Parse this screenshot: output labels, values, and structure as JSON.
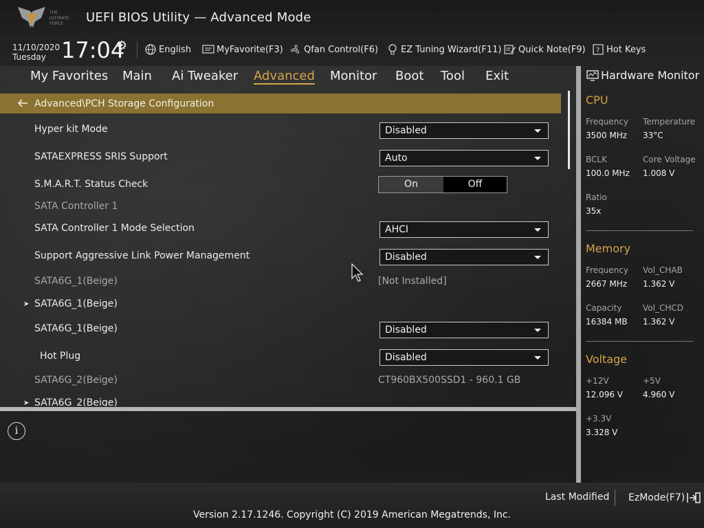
{
  "app": {
    "title": "UEFI BIOS Utility — Advanced Mode",
    "logo_text": "THE ULTIMATE FORCE"
  },
  "datetime": {
    "date": "11/10/2020",
    "weekday": "Tuesday",
    "time": "17:04"
  },
  "toolbar": {
    "language": "English",
    "my_favorite": "MyFavorite(F3)",
    "qfan": "Qfan Control(F6)",
    "ez_tuning": "EZ Tuning Wizard(F11)",
    "quick_note": "Quick Note(F9)",
    "hot_keys": "Hot Keys"
  },
  "tabs": [
    {
      "label": "My Favorites",
      "active": false
    },
    {
      "label": "Main",
      "active": false
    },
    {
      "label": "Ai Tweaker",
      "active": false
    },
    {
      "label": "Advanced",
      "active": true
    },
    {
      "label": "Monitor",
      "active": false
    },
    {
      "label": "Boot",
      "active": false
    },
    {
      "label": "Tool",
      "active": false
    },
    {
      "label": "Exit",
      "active": false
    }
  ],
  "breadcrumb": "Advanced\\PCH Storage Configuration",
  "settings": [
    {
      "label": "Hyper kit Mode",
      "type": "dropdown",
      "value": "Disabled"
    },
    {
      "label": "SATAEXPRESS SRIS Support",
      "type": "dropdown",
      "value": "Auto"
    },
    {
      "label": "S.M.A.R.T. Status Check",
      "type": "toggle",
      "on": "On",
      "off": "Off",
      "selected": "Off"
    },
    {
      "label": "SATA Controller 1",
      "type": "header"
    },
    {
      "label": "SATA Controller 1 Mode Selection",
      "type": "dropdown",
      "value": "AHCI"
    },
    {
      "label": "Support Aggressive Link Power Management",
      "type": "dropdown",
      "value": "Disabled"
    },
    {
      "label": "SATA6G_1(Beige)",
      "type": "info",
      "value": "[Not Installed]"
    },
    {
      "label": "SATA6G_1(Beige)",
      "type": "submenu"
    },
    {
      "label": "SATA6G_1(Beige)",
      "type": "dropdown",
      "value": "Disabled"
    },
    {
      "label": "Hot Plug",
      "type": "dropdown",
      "value": "Disabled"
    },
    {
      "label": "SATA6G_2(Beige)",
      "type": "info",
      "value": "CT960BX500SSD1 - 960.1 GB"
    },
    {
      "label": "SATA6G_2(Beige)",
      "type": "submenu"
    }
  ],
  "hardware_monitor": {
    "title": "Hardware Monitor",
    "cpu": {
      "heading": "CPU",
      "frequency_label": "Frequency",
      "frequency": "3500 MHz",
      "temperature_label": "Temperature",
      "temperature": "33°C",
      "bclk_label": "BCLK",
      "bclk": "100.0 MHz",
      "core_voltage_label": "Core Voltage",
      "core_voltage": "1.008 V",
      "ratio_label": "Ratio",
      "ratio": "35x"
    },
    "memory": {
      "heading": "Memory",
      "frequency_label": "Frequency",
      "frequency": "2667 MHz",
      "vol_chab_label": "Vol_CHAB",
      "vol_chab": "1.362 V",
      "capacity_label": "Capacity",
      "capacity": "16384 MB",
      "vol_chcd_label": "Vol_CHCD",
      "vol_chcd": "1.362 V"
    },
    "voltage": {
      "heading": "Voltage",
      "v12_label": "+12V",
      "v12": "12.096 V",
      "v5_label": "+5V",
      "v5": "4.960 V",
      "v33_label": "+3.3V",
      "v33": "3.328 V"
    }
  },
  "footer": {
    "last_modified": "Last Modified",
    "ez_mode": "EzMode(F7)",
    "version": "Version 2.17.1246. Copyright (C) 2019 American Megatrends, Inc."
  },
  "colors": {
    "accent": "#d5a44a",
    "breadcrumb_bg": "#8a7232"
  }
}
